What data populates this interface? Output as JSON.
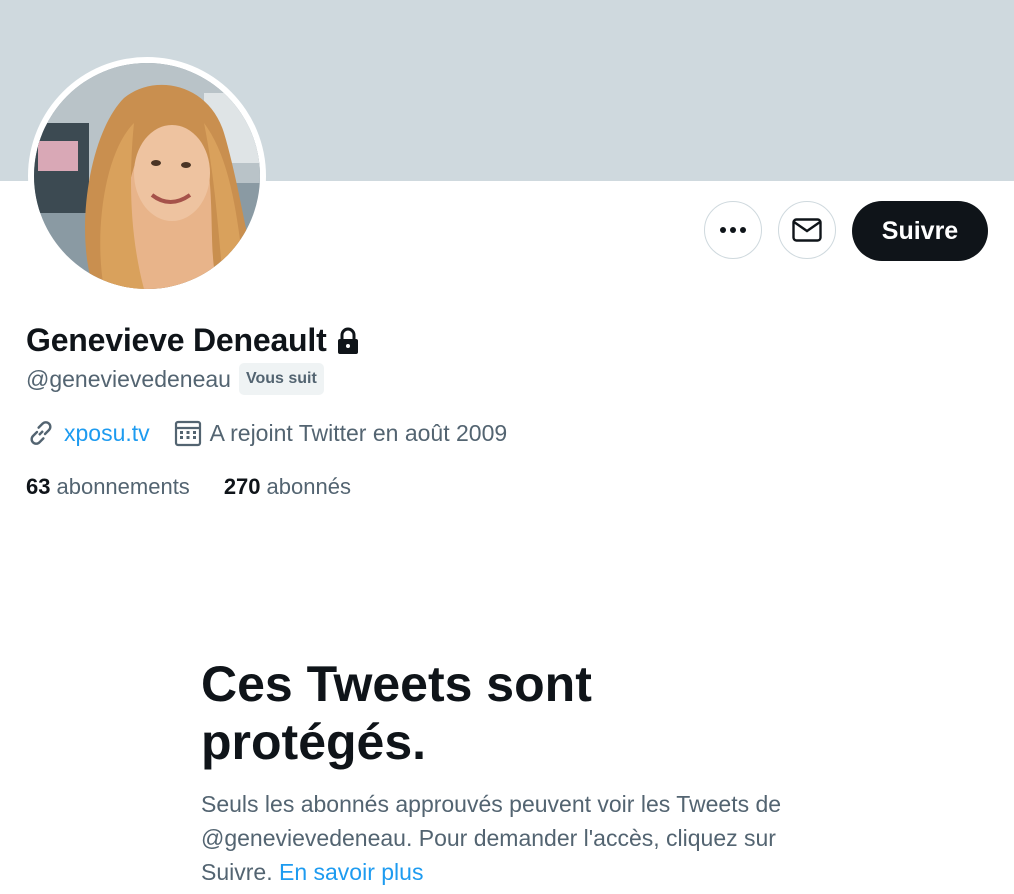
{
  "profile": {
    "display_name": "Genevieve Deneault",
    "handle": "@genevievedeneau",
    "follows_you_badge": "Vous suit",
    "website": "xposu.tv",
    "joined": "A rejoint Twitter en août 2009",
    "following_count": "63",
    "following_label": "abonnements",
    "followers_count": "270",
    "followers_label": "abonnés"
  },
  "actions": {
    "more_icon": "more-icon",
    "message_icon": "envelope-icon",
    "follow_label": "Suivre"
  },
  "protected": {
    "title": "Ces Tweets sont protégés.",
    "body": "Seuls les abonnés approuvés peuvent voir les Tweets de @genevievedeneau. Pour demander l'accès, cliquez sur Suivre.",
    "learn_more": "En savoir plus"
  },
  "colors": {
    "banner": "#cfd9de",
    "accent": "#1d9bf0",
    "primary_text": "#0f1419",
    "secondary_text": "#536471"
  }
}
